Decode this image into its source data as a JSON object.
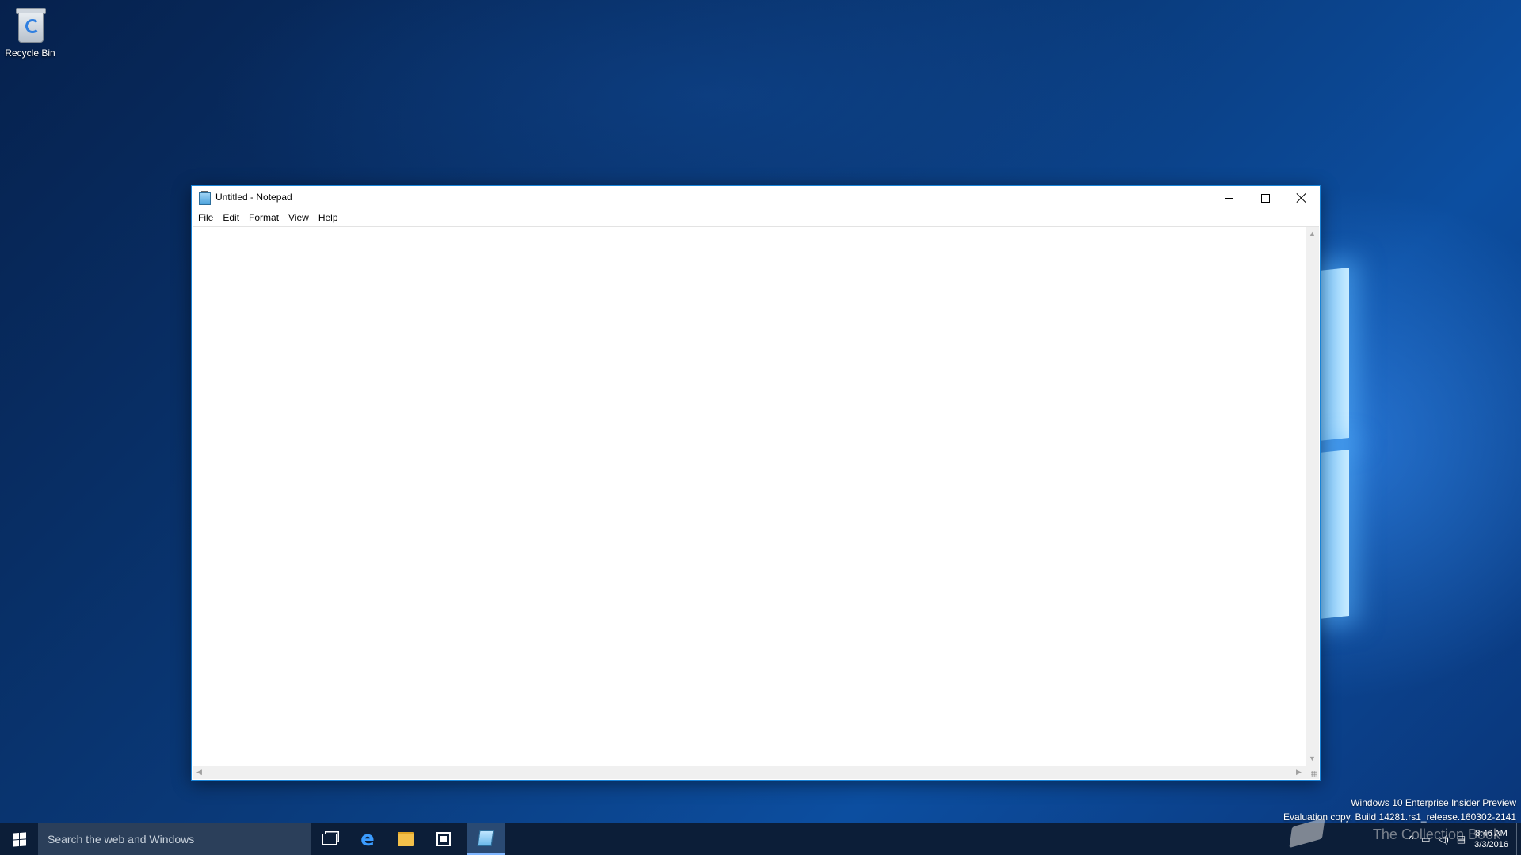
{
  "desktop": {
    "icons": [
      {
        "label": "Recycle Bin",
        "icon": "recycle-bin-icon"
      }
    ]
  },
  "notepad": {
    "title": "Untitled - Notepad",
    "icon": "notepad-icon",
    "menu": [
      "File",
      "Edit",
      "Format",
      "View",
      "Help"
    ],
    "content": "",
    "caption_buttons": [
      "minimize-icon",
      "maximize-icon",
      "close-icon"
    ]
  },
  "watermark": {
    "line1": "Windows 10 Enterprise Insider Preview",
    "line2": "Evaluation copy. Build 14281.rs1_release.160302-2141"
  },
  "taskbar": {
    "search_placeholder": "Search the web and Windows",
    "pinned": [
      "task-view-icon",
      "edge-icon",
      "file-explorer-icon",
      "store-icon",
      "notepad-icon"
    ],
    "active_app": "notepad",
    "overlay_text": "The Collection Book",
    "clock": {
      "time": "8:46 AM",
      "date": "3/3/2016"
    }
  },
  "colors": {
    "window_border": "#1883d7",
    "taskbar": "#0c1e38",
    "search_box": "#2b3f5a"
  }
}
